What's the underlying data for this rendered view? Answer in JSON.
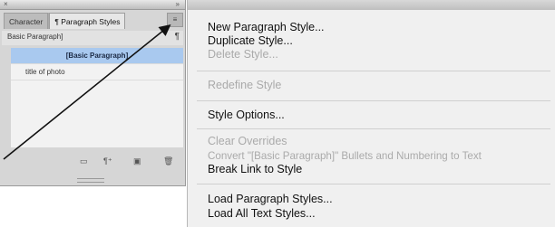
{
  "panel": {
    "tabs": [
      "Character",
      "¶ Paragraph Styles"
    ],
    "menu_button_glyph": "≡",
    "current_style": "Basic Paragraph]",
    "new_style_glyph": "¶",
    "styles": [
      "[Basic Paragraph]",
      "title of photo"
    ],
    "titlebar_close": "×",
    "titlebar_collapse": "»"
  },
  "icons": {
    "menu": "panel-menu-icon",
    "paragraph": "paragraph-mark-icon",
    "arrow": "pointer-arrow"
  },
  "colors": {
    "selection": "#a9c9ef",
    "menu_background": "#f0f0f0",
    "disabled_text": "#aaaaaa"
  },
  "menu": {
    "new_paragraph_style": "New Paragraph Style...",
    "duplicate_style": "Duplicate Style...",
    "delete_style": "Delete Style...",
    "redefine_style": "Redefine Style",
    "style_options": "Style Options...",
    "clear_overrides": "Clear Overrides",
    "convert_bullets": "Convert \"[Basic Paragraph]\" Bullets and Numbering to Text",
    "break_link": "Break Link to Style",
    "load_paragraph_styles": "Load Paragraph Styles...",
    "load_all_text_styles": "Load All Text Styles..."
  }
}
